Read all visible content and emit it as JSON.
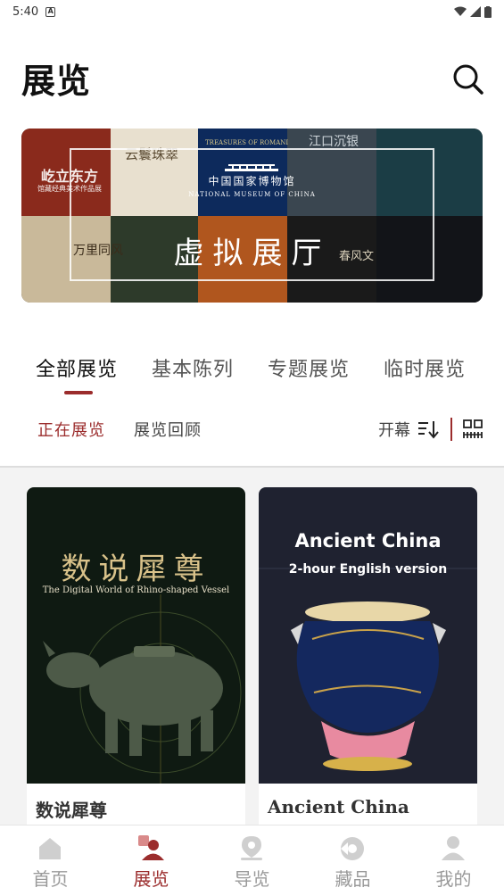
{
  "status_bar": {
    "time": "5:40",
    "notif_letter": "A"
  },
  "header": {
    "title": "展览"
  },
  "banner": {
    "tiles": [
      "屹立东方",
      "馆藏经典美术作品展",
      "云鬟珠翠",
      "TREASURES OF ROMANI",
      "江口沉银",
      "万里同风",
      "春风文"
    ],
    "museum_name": "中国国家博物馆",
    "museum_name_en": "NATIONAL MUSEUM OF CHINA",
    "title": "虚拟展厅"
  },
  "tabs": [
    {
      "label": "全部展览",
      "active": true
    },
    {
      "label": "基本陈列",
      "active": false
    },
    {
      "label": "专题展览",
      "active": false
    },
    {
      "label": "临时展览",
      "active": false
    }
  ],
  "subtabs": [
    {
      "label": "正在展览",
      "active": true
    },
    {
      "label": "展览回顾",
      "active": false
    }
  ],
  "sort": {
    "label": "开幕"
  },
  "cards": [
    {
      "poster_title": "数说犀尊",
      "poster_subtitle": "The Digital World of Rhino-shaped Vessel",
      "title": "数说犀尊"
    },
    {
      "poster_title": "Ancient China",
      "poster_subtitle": "2-hour English version",
      "title": "Ancient China"
    }
  ],
  "bottom_nav": [
    {
      "label": "首页",
      "icon": "home-icon",
      "active": false
    },
    {
      "label": "展览",
      "icon": "exhibition-icon",
      "active": true
    },
    {
      "label": "导览",
      "icon": "location-icon",
      "active": false
    },
    {
      "label": "藏品",
      "icon": "collection-icon",
      "active": false
    },
    {
      "label": "我的",
      "icon": "profile-icon",
      "active": false
    }
  ],
  "colors": {
    "accent": "#9b2c2c",
    "inactive": "#9a9a9a",
    "list_bg": "#f3f3f3"
  }
}
